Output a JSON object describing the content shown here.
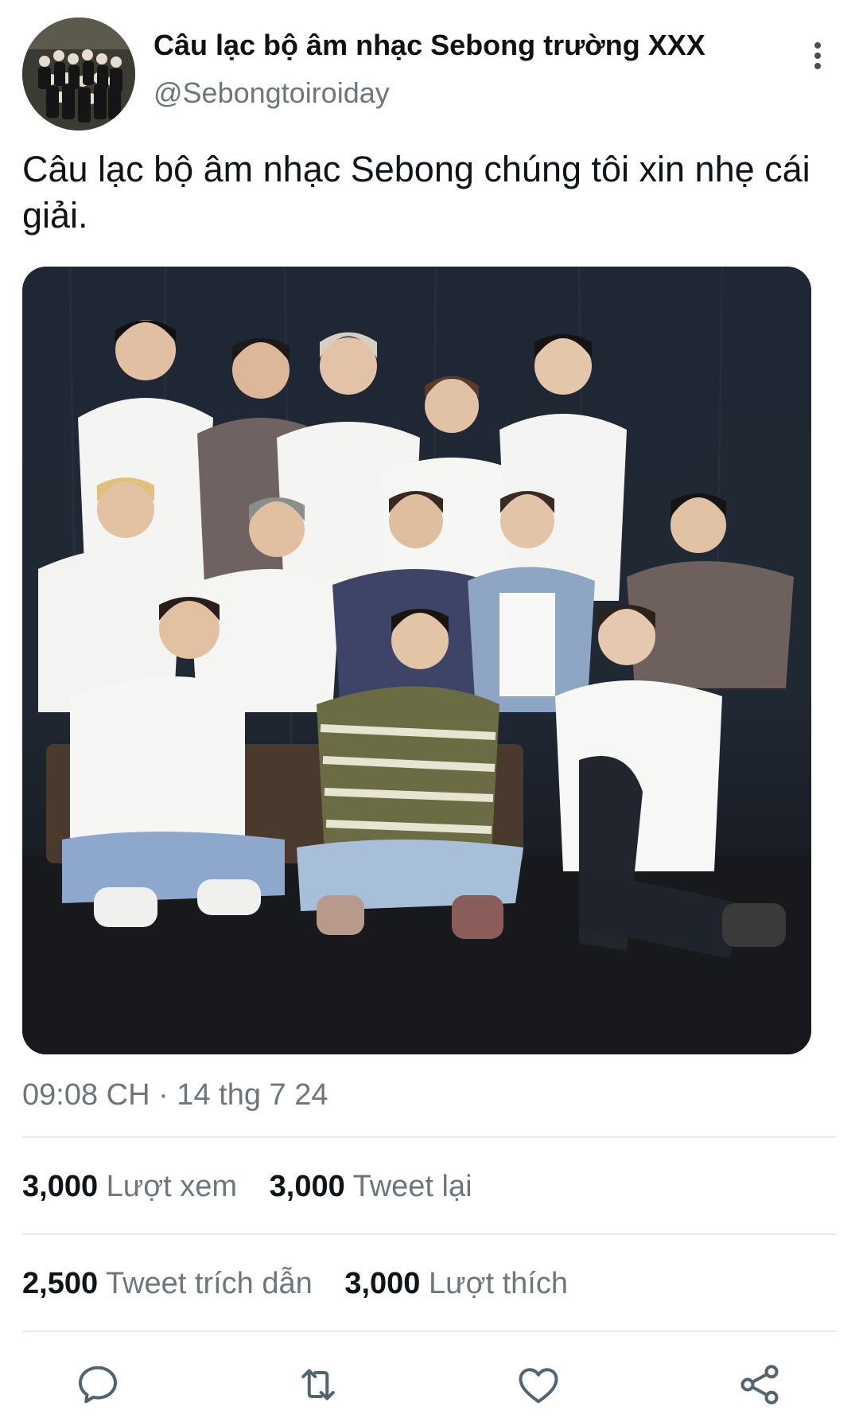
{
  "author": {
    "name": "Câu lạc bộ âm nhạc Sebong trường XXX",
    "handle": "@Sebongtoiroiday"
  },
  "tweet": {
    "text": "Câu lạc bộ âm nhạc Sebong chúng tôi xin nhẹ cái giải.",
    "timestamp": "09:08 CH · 14 thg 7 24"
  },
  "stats": {
    "views": {
      "count": "3,000",
      "label": "Lượt xem"
    },
    "retweets": {
      "count": "3,000",
      "label": "Tweet lại"
    },
    "quotes": {
      "count": "2,500",
      "label": "Tweet trích dẫn"
    },
    "likes": {
      "count": "3,000",
      "label": "Lượt thích"
    }
  },
  "actions": [
    "reply-icon",
    "retweet-icon",
    "like-icon",
    "share-icon"
  ],
  "colors": {
    "text": "#0f1419",
    "muted": "#6e767d",
    "divider": "#e6e9eb",
    "icon": "#536471"
  }
}
